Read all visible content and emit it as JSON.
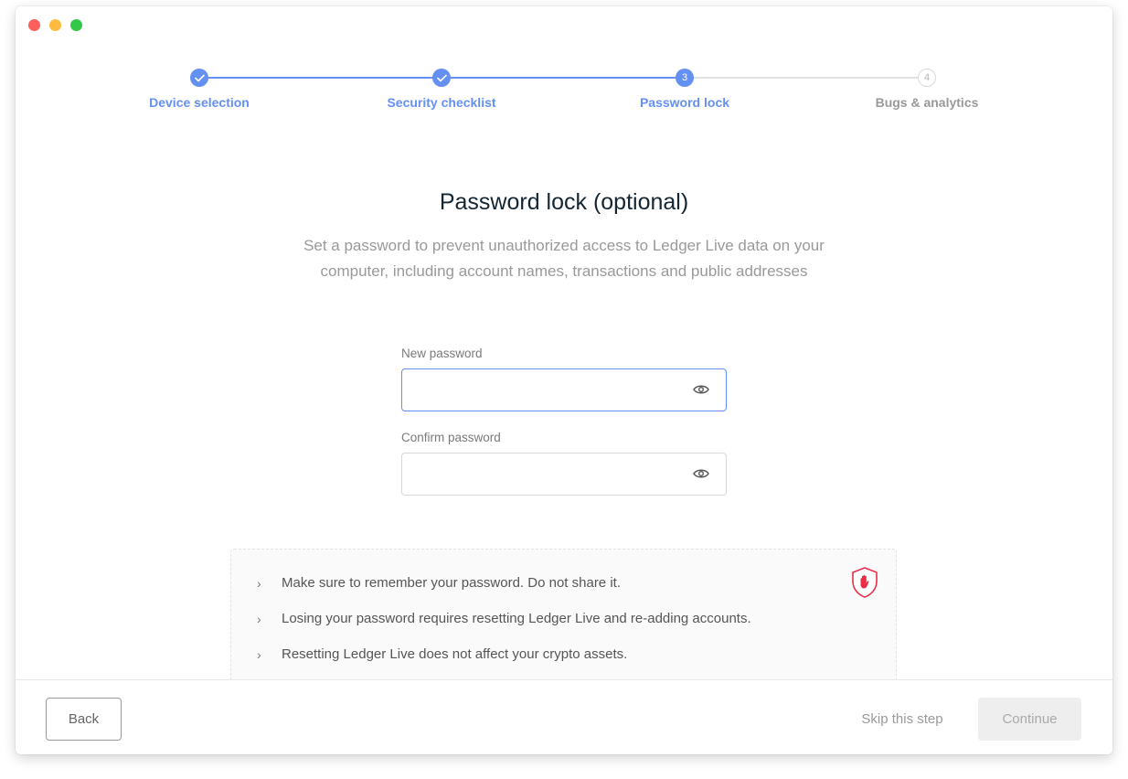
{
  "stepper": {
    "steps": [
      {
        "label": "Device selection",
        "state": "done",
        "marker": ""
      },
      {
        "label": "Security checklist",
        "state": "done",
        "marker": ""
      },
      {
        "label": "Password lock",
        "state": "active",
        "marker": "3"
      },
      {
        "label": "Bugs & analytics",
        "state": "pending",
        "marker": "4"
      }
    ]
  },
  "main": {
    "title": "Password lock (optional)",
    "subtitle_line1": "Set a password to prevent unauthorized access to Ledger Live data on your",
    "subtitle_line2": "computer, including account names, transactions and public addresses"
  },
  "form": {
    "new_password_label": "New password",
    "new_password_value": "",
    "confirm_password_label": "Confirm password",
    "confirm_password_value": ""
  },
  "notice": {
    "items": [
      "Make sure to remember your password. Do not share it.",
      "Losing your password requires resetting Ledger Live and re-adding accounts.",
      "Resetting Ledger Live does not affect your crypto assets."
    ],
    "icon": "shield-hand-icon"
  },
  "footer": {
    "back_label": "Back",
    "skip_label": "Skip this step",
    "continue_label": "Continue"
  },
  "colors": {
    "accent": "#6490f1",
    "danger": "#ea2e49"
  }
}
